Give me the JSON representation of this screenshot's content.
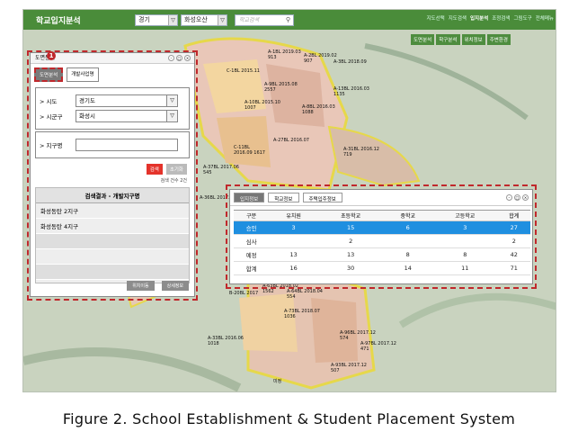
{
  "header": {
    "app_title": "학교입지분석",
    "region_select": "경기",
    "city_select": "화성오산",
    "school_search_placeholder": "학교검색",
    "menu": [
      "지도선택",
      "지도검색",
      "입지분석",
      "조정검색",
      "그림도구",
      "전체메뉴"
    ],
    "active_menu": "입지분석"
  },
  "sub_menu": [
    "도면분석",
    "학구분석",
    "위치정보",
    "주변환경"
  ],
  "map_labels": [
    "A-1BL 2019.03 913",
    "A-2BL 2019.02 907",
    "A-3BL 2018.09",
    "C-1BL 2015.11",
    "A-13BL 2016.03 1135",
    "A-9BL 2015.08 2557",
    "A-10BL 2015.10 1007",
    "A-8BL 2016.03 1088",
    "A-27BL 2016.07",
    "A-31BL 2016.12 719",
    "C-11BL 2016.09 1617",
    "A-37BL 2017.06 545",
    "A-36BL 2017.03",
    "A-63BL 2018.02 1562",
    "A-64BL 2018.04 554",
    "A-73BL 2018.07 1036",
    "A-33BL 2016.06 1018",
    "A-96BL 2017.12 574",
    "A-97BL 2017.12 471",
    "A-93BL 2017.12 507",
    "B-20BL 2017",
    "미정"
  ],
  "search_panel": {
    "title": "도면분석",
    "badge": "1",
    "tabs": [
      "도면분석",
      "개발사업명"
    ],
    "sido_label": "> 시도",
    "sido_value": "경기도",
    "sigungu_label": "> 시군구",
    "sigungu_value": "화성시",
    "district_label": "> 지구명",
    "search_button": "검색",
    "reset_button": "초기화",
    "result_count": "검색 건수 2건",
    "result_title": "검색결과 - 개발지구명",
    "results": [
      "화성동탄 2지구",
      "화성동탄 4지구"
    ],
    "bottom_buttons": [
      "위치이동",
      "상세정보"
    ]
  },
  "info_panel": {
    "tabs": [
      "입지정보",
      "학교정보",
      "주택입주정보"
    ],
    "columns": [
      "구분",
      "유치원",
      "초등학교",
      "중학교",
      "고등학교",
      "합계"
    ],
    "rows": [
      [
        "승인",
        "3",
        "15",
        "6",
        "3",
        "27"
      ],
      [
        "심사",
        "",
        "2",
        "",
        "",
        "2"
      ],
      [
        "예정",
        "13",
        "13",
        "8",
        "8",
        "42"
      ],
      [
        "합계",
        "16",
        "30",
        "14",
        "11",
        "71"
      ]
    ]
  },
  "caption": "Figure 2. School Establishment & Student Placement System",
  "colors": {
    "header_green": "#4a8c3a",
    "highlight_blue": "#1f8fe0",
    "annotation_red": "#c0282c",
    "search_red": "#e4332b"
  }
}
